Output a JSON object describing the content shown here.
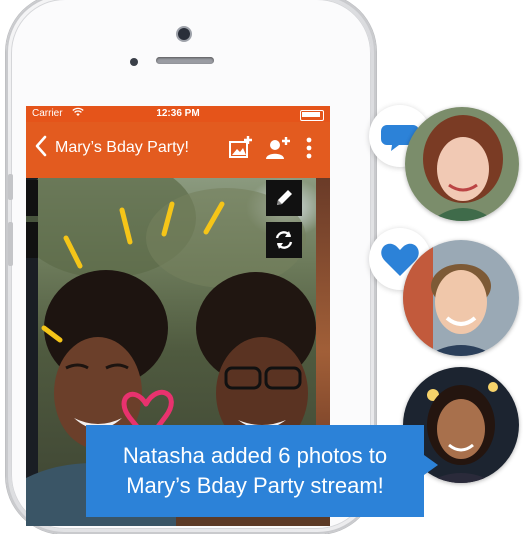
{
  "status_bar": {
    "carrier": "Carrier",
    "time": "12:36 PM"
  },
  "nav_bar": {
    "title": "Mary’s Bday Party!",
    "back_icon": "chevron-left-icon",
    "actions": [
      "add-photo-icon",
      "add-person-icon",
      "more-vertical-icon"
    ]
  },
  "photo_tools": {
    "icons": [
      "pencil-icon",
      "rotate-icon"
    ]
  },
  "activity": [
    {
      "reaction_icon": "comment-icon",
      "avatar": "woman-avatar"
    },
    {
      "reaction_icon": "heart-icon",
      "avatar": "man-avatar"
    },
    {
      "reaction_icon": "",
      "avatar": "natasha-avatar"
    }
  ],
  "toast": {
    "line1": "Natasha added 6 photos to",
    "line2": "Mary’s Bday Party stream!"
  },
  "colors": {
    "brand_orange": "#e35b1f",
    "status_orange": "#e5541a",
    "reaction_blue": "#2c82d8",
    "doodle_yellow": "#f5c518",
    "doodle_pink": "#e8326e",
    "doodle_cyan": "#3fc4e0"
  }
}
